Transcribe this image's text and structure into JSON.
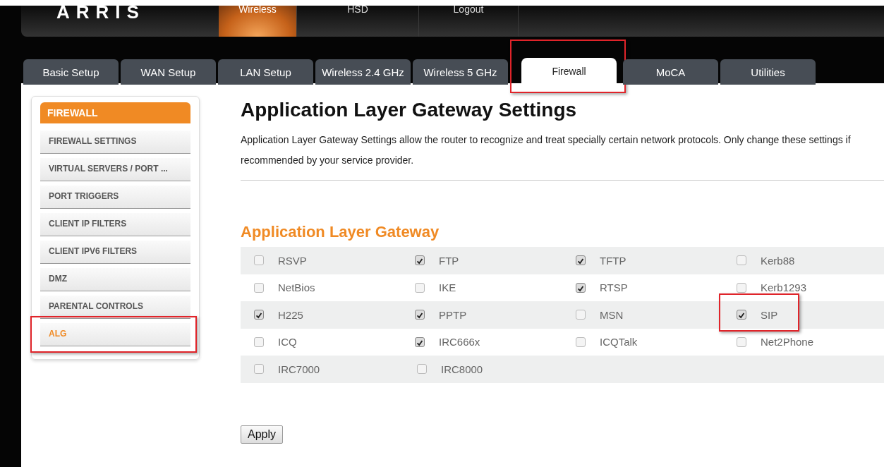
{
  "header": {
    "logo": "ARRIS",
    "nav": [
      {
        "label": "Wireless",
        "selected": true
      },
      {
        "label": "HSD",
        "selected": false
      },
      {
        "label": "Logout",
        "selected": false
      }
    ]
  },
  "tabs": [
    {
      "label": "Basic Setup",
      "selected": false,
      "highlighted": false
    },
    {
      "label": "WAN Setup",
      "selected": false,
      "highlighted": false
    },
    {
      "label": "LAN Setup",
      "selected": false,
      "highlighted": false
    },
    {
      "label": "Wireless 2.4 GHz",
      "selected": false,
      "highlighted": false
    },
    {
      "label": "Wireless 5 GHz",
      "selected": false,
      "highlighted": false
    },
    {
      "label": "Firewall",
      "selected": true,
      "highlighted": true
    },
    {
      "label": "MoCA",
      "selected": false,
      "highlighted": false
    },
    {
      "label": "Utilities",
      "selected": false,
      "highlighted": false
    }
  ],
  "sidebar": {
    "title": "FIREWALL",
    "items": [
      {
        "label": "FIREWALL SETTINGS",
        "selected": false,
        "highlighted": false
      },
      {
        "label": "VIRTUAL SERVERS / PORT ...",
        "selected": false,
        "highlighted": false
      },
      {
        "label": "PORT TRIGGERS",
        "selected": false,
        "highlighted": false
      },
      {
        "label": "CLIENT IP FILTERS",
        "selected": false,
        "highlighted": false
      },
      {
        "label": "CLIENT IPV6 FILTERS",
        "selected": false,
        "highlighted": false
      },
      {
        "label": "DMZ",
        "selected": false,
        "highlighted": false
      },
      {
        "label": "PARENTAL CONTROLS",
        "selected": false,
        "highlighted": false
      },
      {
        "label": "ALG",
        "selected": true,
        "highlighted": true
      }
    ]
  },
  "page": {
    "title": "Application Layer Gateway Settings",
    "description": "Application Layer Gateway Settings allow the router to recognize and treat specially certain network protocols. Only change these settings if recommended by your service provider.",
    "section_title": "Application Layer Gateway"
  },
  "protocols": [
    [
      {
        "label": "RSVP",
        "checked": false,
        "highlighted": false
      },
      {
        "label": "FTP",
        "checked": true,
        "highlighted": false
      },
      {
        "label": "TFTP",
        "checked": true,
        "highlighted": false
      },
      {
        "label": "Kerb88",
        "checked": false,
        "highlighted": false
      }
    ],
    [
      {
        "label": "NetBios",
        "checked": false,
        "highlighted": false
      },
      {
        "label": "IKE",
        "checked": false,
        "highlighted": false
      },
      {
        "label": "RTSP",
        "checked": true,
        "highlighted": false
      },
      {
        "label": "Kerb1293",
        "checked": false,
        "highlighted": false
      }
    ],
    [
      {
        "label": "H225",
        "checked": true,
        "highlighted": false
      },
      {
        "label": "PPTP",
        "checked": true,
        "highlighted": false
      },
      {
        "label": "MSN",
        "checked": false,
        "highlighted": false
      },
      {
        "label": "SIP",
        "checked": true,
        "highlighted": true
      }
    ],
    [
      {
        "label": "ICQ",
        "checked": false,
        "highlighted": false
      },
      {
        "label": "IRC666x",
        "checked": true,
        "highlighted": false
      },
      {
        "label": "ICQTalk",
        "checked": false,
        "highlighted": false
      },
      {
        "label": "Net2Phone",
        "checked": false,
        "highlighted": false
      }
    ],
    [
      {
        "label": "IRC7000",
        "checked": false,
        "highlighted": false
      },
      {
        "label": "IRC8000",
        "checked": false,
        "highlighted": false
      }
    ]
  ],
  "apply_button": "Apply"
}
